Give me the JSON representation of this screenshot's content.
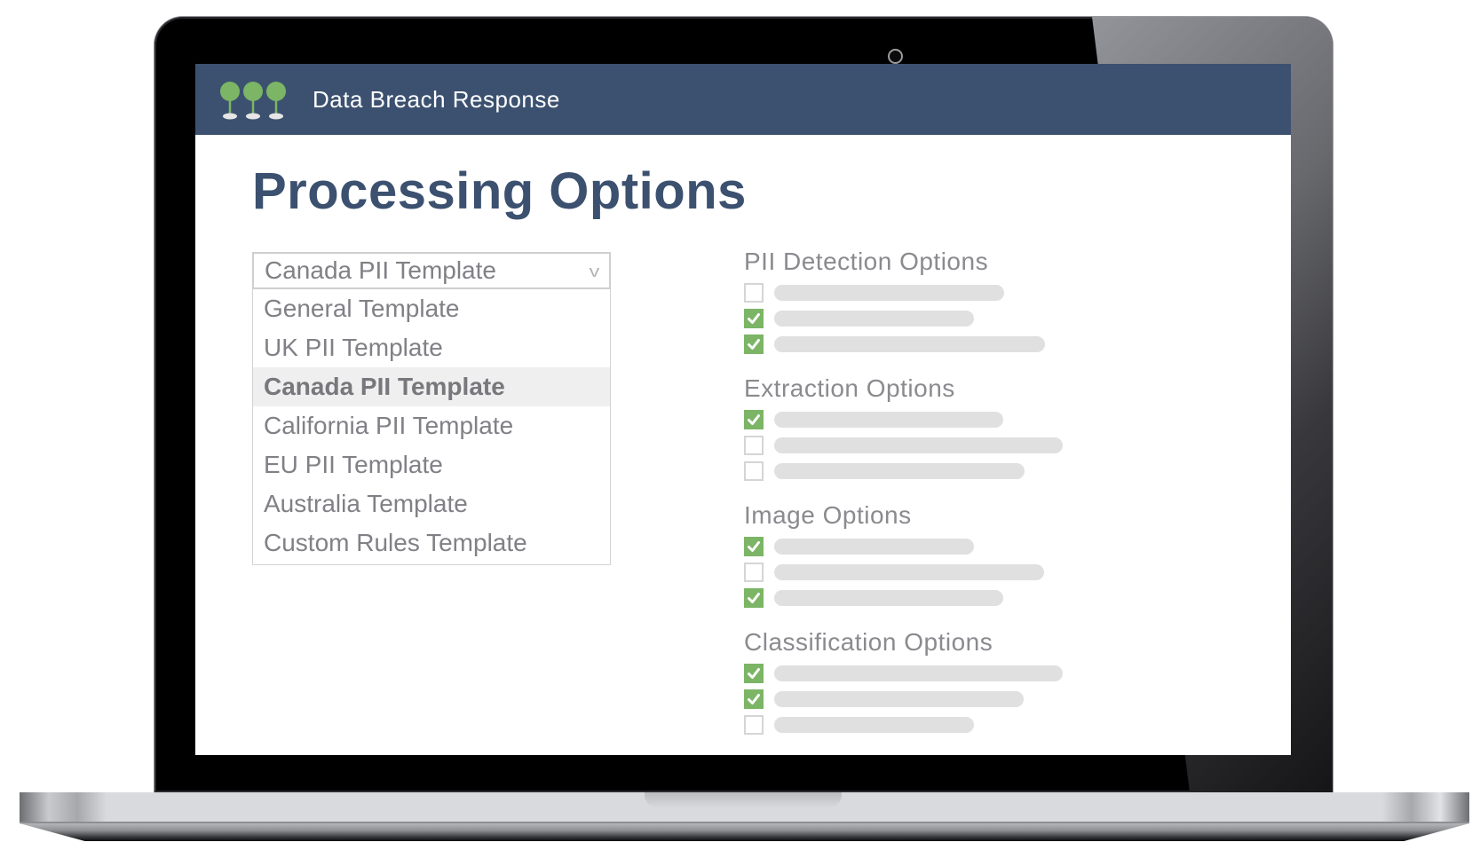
{
  "app": {
    "title": "Data Breach Response",
    "logo_icon": "three-trees-logo",
    "brand_colors": {
      "header": "#3c5170",
      "accent": "#7bb565"
    }
  },
  "page": {
    "title": "Processing Options"
  },
  "template_dropdown": {
    "selected": "Canada PII Template",
    "expanded": true,
    "caret_icon": "chevron-down-icon",
    "options": [
      {
        "label": "General Template",
        "selected": false
      },
      {
        "label": "UK PII Template",
        "selected": false
      },
      {
        "label": "Canada PII Template",
        "selected": true
      },
      {
        "label": "California PII Template",
        "selected": false
      },
      {
        "label": "EU PII Template",
        "selected": false
      },
      {
        "label": "Australia Template",
        "selected": false
      },
      {
        "label": "Custom Rules Template",
        "selected": false
      }
    ]
  },
  "option_groups": [
    {
      "title": "PII Detection Options",
      "items": [
        {
          "checked": false
        },
        {
          "checked": true
        },
        {
          "checked": true
        }
      ]
    },
    {
      "title": "Extraction Options",
      "items": [
        {
          "checked": true
        },
        {
          "checked": false
        },
        {
          "checked": false
        }
      ]
    },
    {
      "title": "Image Options",
      "items": [
        {
          "checked": true
        },
        {
          "checked": false
        },
        {
          "checked": true
        }
      ]
    },
    {
      "title": "Classification Options",
      "items": [
        {
          "checked": true
        },
        {
          "checked": true
        },
        {
          "checked": false
        }
      ]
    }
  ]
}
